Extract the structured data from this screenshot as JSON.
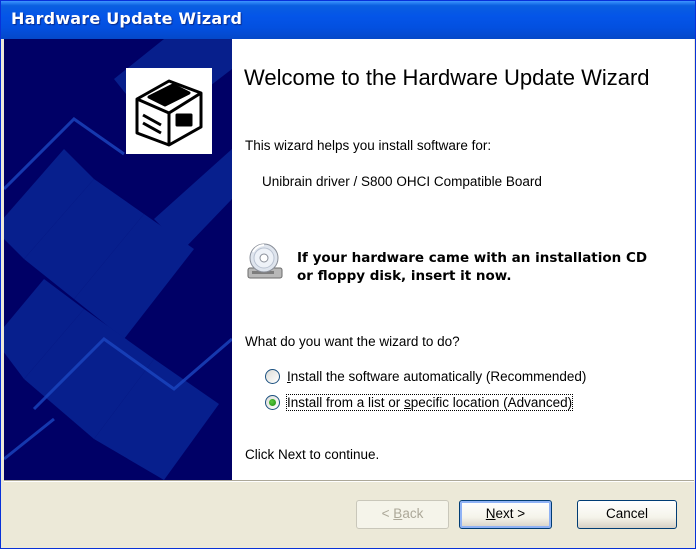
{
  "window": {
    "title": "Hardware Update Wizard"
  },
  "content": {
    "heading": "Welcome to the Hardware Update Wizard",
    "intro": "This wizard helps you install software for:",
    "device": "Unibrain driver / S800 OHCI Compatible Board",
    "cd_prompt_line1": "If your hardware came with an installation CD",
    "cd_prompt_line2": "or floppy disk, insert it now.",
    "question": "What do you want the wizard to do?",
    "options": [
      {
        "prefix": "",
        "accel": "I",
        "rest": "nstall the software automatically (Recommended)",
        "selected": false
      },
      {
        "prefix": "Install from a list or ",
        "accel": "s",
        "rest": "pecific location (Advanced)",
        "selected": true
      }
    ],
    "continue_text": "Click Next to continue."
  },
  "footer": {
    "back": {
      "prefix": "< ",
      "accel": "B",
      "rest": "ack",
      "enabled": false
    },
    "next": {
      "prefix": "",
      "accel": "N",
      "rest": "ext >",
      "enabled": true
    },
    "cancel": {
      "label": "Cancel",
      "enabled": true
    }
  },
  "icons": {
    "sidebar_logo": "hardware-device-icon",
    "cd": "cd-disk-icon"
  },
  "colors": {
    "title_bar": "#0455e8",
    "sidebar": "#000066",
    "radio_selected": "#1a8a10"
  }
}
